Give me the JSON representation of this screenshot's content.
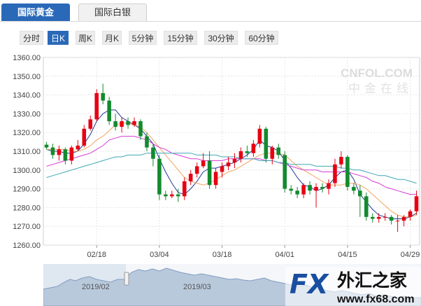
{
  "tabs": [
    {
      "label": "国际黄金",
      "active": true
    },
    {
      "label": "国际白银",
      "active": false
    }
  ],
  "periods": [
    {
      "label": "分时",
      "active": false
    },
    {
      "label": "日K",
      "active": true
    },
    {
      "label": "周K",
      "active": false
    },
    {
      "label": "月K",
      "active": false
    },
    {
      "label": "5分钟",
      "active": false
    },
    {
      "label": "15分钟",
      "active": false
    },
    {
      "label": "30分钟",
      "active": false
    },
    {
      "label": "60分钟",
      "active": false
    }
  ],
  "watermark": {
    "brand": "CNFOL.COM",
    "cn": "中金在线"
  },
  "logo": {
    "fx": "FX",
    "cn": "外汇之家",
    "url": "www.fx68.com"
  },
  "navigator": {
    "labels": [
      "2019/02",
      "2019/03"
    ]
  },
  "colors": {
    "up": "#e60012",
    "down": "#138a2e",
    "ma5": "#1f3a93",
    "ma10": "#f4a460",
    "ma20": "#d63bd6",
    "ma60": "#3fa7b5",
    "accent": "#2a69b8"
  },
  "chart_data": {
    "type": "candlestick",
    "y_ticks": [
      "1360.00",
      "1350.00",
      "1340.00",
      "1330.00",
      "1320.00",
      "1310.00",
      "1300.00",
      "1290.00",
      "1280.00",
      "1270.00",
      "1260.00"
    ],
    "ylim": [
      1260,
      1360
    ],
    "x_labels": [
      {
        "index": 8,
        "label": "02/18"
      },
      {
        "index": 18,
        "label": "03/04"
      },
      {
        "index": 28,
        "label": "03/18"
      },
      {
        "index": 38,
        "label": "04/01"
      },
      {
        "index": 48,
        "label": "04/15"
      },
      {
        "index": 58,
        "label": "04/29"
      }
    ],
    "candles": [
      [
        1313.5,
        1312.0,
        1315.0,
        1311.0
      ],
      [
        1312.0,
        1308.0,
        1314.0,
        1306.0
      ],
      [
        1308.0,
        1311.0,
        1313.0,
        1305.0
      ],
      [
        1311.0,
        1305.0,
        1312.0,
        1303.0
      ],
      [
        1305.0,
        1312.0,
        1313.0,
        1303.0
      ],
      [
        1311.0,
        1313.0,
        1316.0,
        1310.0
      ],
      [
        1313.0,
        1322.0,
        1324.0,
        1312.0
      ],
      [
        1322.0,
        1327.0,
        1329.0,
        1321.0
      ],
      [
        1327.0,
        1341.0,
        1343.0,
        1326.0
      ],
      [
        1341.0,
        1337.0,
        1346.0,
        1335.0
      ],
      [
        1337.0,
        1326.0,
        1339.0,
        1324.0
      ],
      [
        1326.0,
        1323.0,
        1330.0,
        1321.0
      ],
      [
        1323.0,
        1326.0,
        1328.0,
        1320.0
      ],
      [
        1326.0,
        1324.0,
        1328.0,
        1322.0
      ],
      [
        1324.0,
        1326.0,
        1328.0,
        1323.0
      ],
      [
        1326.0,
        1318.0,
        1327.0,
        1316.0
      ],
      [
        1318.0,
        1312.0,
        1320.0,
        1310.0
      ],
      [
        1312.0,
        1306.0,
        1314.0,
        1302.0
      ],
      [
        1306.0,
        1287.0,
        1308.0,
        1284.0
      ],
      [
        1287.0,
        1286.0,
        1289.0,
        1284.0
      ],
      [
        1286.0,
        1287.0,
        1289.0,
        1285.0
      ],
      [
        1287.0,
        1286.0,
        1290.0,
        1283.0
      ],
      [
        1286.0,
        1294.0,
        1296.0,
        1284.0
      ],
      [
        1294.0,
        1298.0,
        1300.0,
        1292.0
      ],
      [
        1298.0,
        1302.0,
        1304.0,
        1296.0
      ],
      [
        1302.0,
        1305.0,
        1309.0,
        1301.0
      ],
      [
        1305.0,
        1292.0,
        1310.0,
        1290.0
      ],
      [
        1292.0,
        1299.0,
        1301.0,
        1290.0
      ],
      [
        1299.0,
        1302.0,
        1304.0,
        1296.0
      ],
      [
        1302.0,
        1304.0,
        1307.0,
        1300.0
      ],
      [
        1304.0,
        1306.0,
        1309.0,
        1301.0
      ],
      [
        1306.0,
        1310.0,
        1312.0,
        1304.0
      ],
      [
        1310.0,
        1309.0,
        1313.0,
        1307.0
      ],
      [
        1309.0,
        1314.0,
        1316.0,
        1307.0
      ],
      [
        1314.0,
        1322.0,
        1324.0,
        1312.0
      ],
      [
        1322.0,
        1306.0,
        1323.0,
        1304.0
      ],
      [
        1306.0,
        1312.0,
        1313.0,
        1303.0
      ],
      [
        1312.0,
        1308.0,
        1314.0,
        1306.0
      ],
      [
        1308.0,
        1290.0,
        1310.0,
        1288.0
      ],
      [
        1290.0,
        1289.0,
        1292.0,
        1287.0
      ],
      [
        1289.0,
        1287.0,
        1291.0,
        1285.0
      ],
      [
        1287.0,
        1292.0,
        1293.0,
        1285.0
      ],
      [
        1292.0,
        1289.0,
        1294.0,
        1287.0
      ],
      [
        1289.0,
        1291.0,
        1293.0,
        1280.0
      ],
      [
        1291.0,
        1290.0,
        1293.0,
        1288.0
      ],
      [
        1290.0,
        1293.0,
        1295.0,
        1287.0
      ],
      [
        1293.0,
        1303.0,
        1306.0,
        1291.0
      ],
      [
        1303.0,
        1307.0,
        1310.0,
        1301.0
      ],
      [
        1307.0,
        1291.0,
        1308.0,
        1289.0
      ],
      [
        1291.0,
        1289.0,
        1293.0,
        1287.0
      ],
      [
        1289.0,
        1286.0,
        1292.0,
        1275.0
      ],
      [
        1286.0,
        1275.0,
        1288.0,
        1273.0
      ],
      [
        1275.0,
        1274.0,
        1277.0,
        1272.0
      ],
      [
        1274.0,
        1275.0,
        1277.0,
        1272.0
      ],
      [
        1275.0,
        1275.0,
        1277.0,
        1273.0
      ],
      [
        1275.0,
        1273.0,
        1276.0,
        1271.0
      ],
      [
        1273.0,
        1273.0,
        1276.0,
        1267.0
      ],
      [
        1273.0,
        1275.0,
        1276.0,
        1270.0
      ],
      [
        1275.0,
        1278.0,
        1279.0,
        1273.0
      ],
      [
        1278.0,
        1286.0,
        1289.0,
        1276.0
      ]
    ],
    "ma": [
      {
        "name": "MA5",
        "values": [
          1311,
          1310,
          1310,
          1309,
          1309,
          1310,
          1314,
          1319,
          1326,
          1330,
          1332,
          1332,
          1328,
          1326,
          1324,
          1322,
          1318,
          1314,
          1306,
          1299,
          1293,
          1288,
          1287,
          1290,
          1294,
          1299,
          1301,
          1301,
          1302,
          1303,
          1304,
          1306,
          1308,
          1311,
          1316,
          1313,
          1312,
          1310,
          1305,
          1301,
          1296,
          1292,
          1291,
          1289,
          1290,
          1292,
          1296,
          1299,
          1300,
          1295,
          1287,
          1283,
          1279,
          1276,
          1275,
          1274,
          1274,
          1274,
          1275,
          1277
        ]
      },
      {
        "name": "MA10",
        "values": [
          1311,
          1311,
          1311,
          1311,
          1310,
          1310,
          1311,
          1313,
          1316,
          1318,
          1321,
          1324,
          1325,
          1325,
          1324,
          1323,
          1320,
          1316,
          1312,
          1308,
          1304,
          1300,
          1296,
          1294,
          1293,
          1292,
          1293,
          1295,
          1297,
          1299,
          1300,
          1302,
          1304,
          1306,
          1308,
          1309,
          1309,
          1309,
          1308,
          1305,
          1302,
          1300,
          1298,
          1296,
          1294,
          1292,
          1292,
          1292,
          1293,
          1293,
          1292,
          1290,
          1287,
          1284,
          1281,
          1278,
          1276,
          1275,
          1275,
          1276
        ]
      },
      {
        "name": "MA20",
        "values": [
          1302,
          1303,
          1304,
          1305,
          1306,
          1307,
          1308,
          1309,
          1311,
          1313,
          1316,
          1317,
          1318,
          1318,
          1318,
          1317,
          1316,
          1314,
          1312,
          1311,
          1309,
          1308,
          1307,
          1306,
          1306,
          1305,
          1305,
          1305,
          1305,
          1306,
          1306,
          1306,
          1306,
          1306,
          1306,
          1305,
          1305,
          1304,
          1303,
          1302,
          1301,
          1300,
          1300,
          1300,
          1299,
          1299,
          1299,
          1299,
          1299,
          1298,
          1297,
          1296,
          1294,
          1293,
          1291,
          1290,
          1289,
          1288,
          1287,
          1287
        ]
      },
      {
        "name": "MA60",
        "values": [
          1296,
          1297,
          1298,
          1299,
          1300,
          1301,
          1302,
          1303,
          1304,
          1305,
          1306,
          1307,
          1307,
          1308,
          1308,
          1308,
          1309,
          1309,
          1309,
          1309,
          1309,
          1309,
          1309,
          1309,
          1308,
          1308,
          1308,
          1308,
          1307,
          1307,
          1307,
          1306,
          1306,
          1306,
          1305,
          1305,
          1305,
          1304,
          1304,
          1303,
          1303,
          1303,
          1303,
          1302,
          1302,
          1302,
          1302,
          1301,
          1301,
          1300,
          1300,
          1299,
          1298,
          1297,
          1297,
          1296,
          1295,
          1295,
          1294,
          1293
        ]
      }
    ]
  }
}
